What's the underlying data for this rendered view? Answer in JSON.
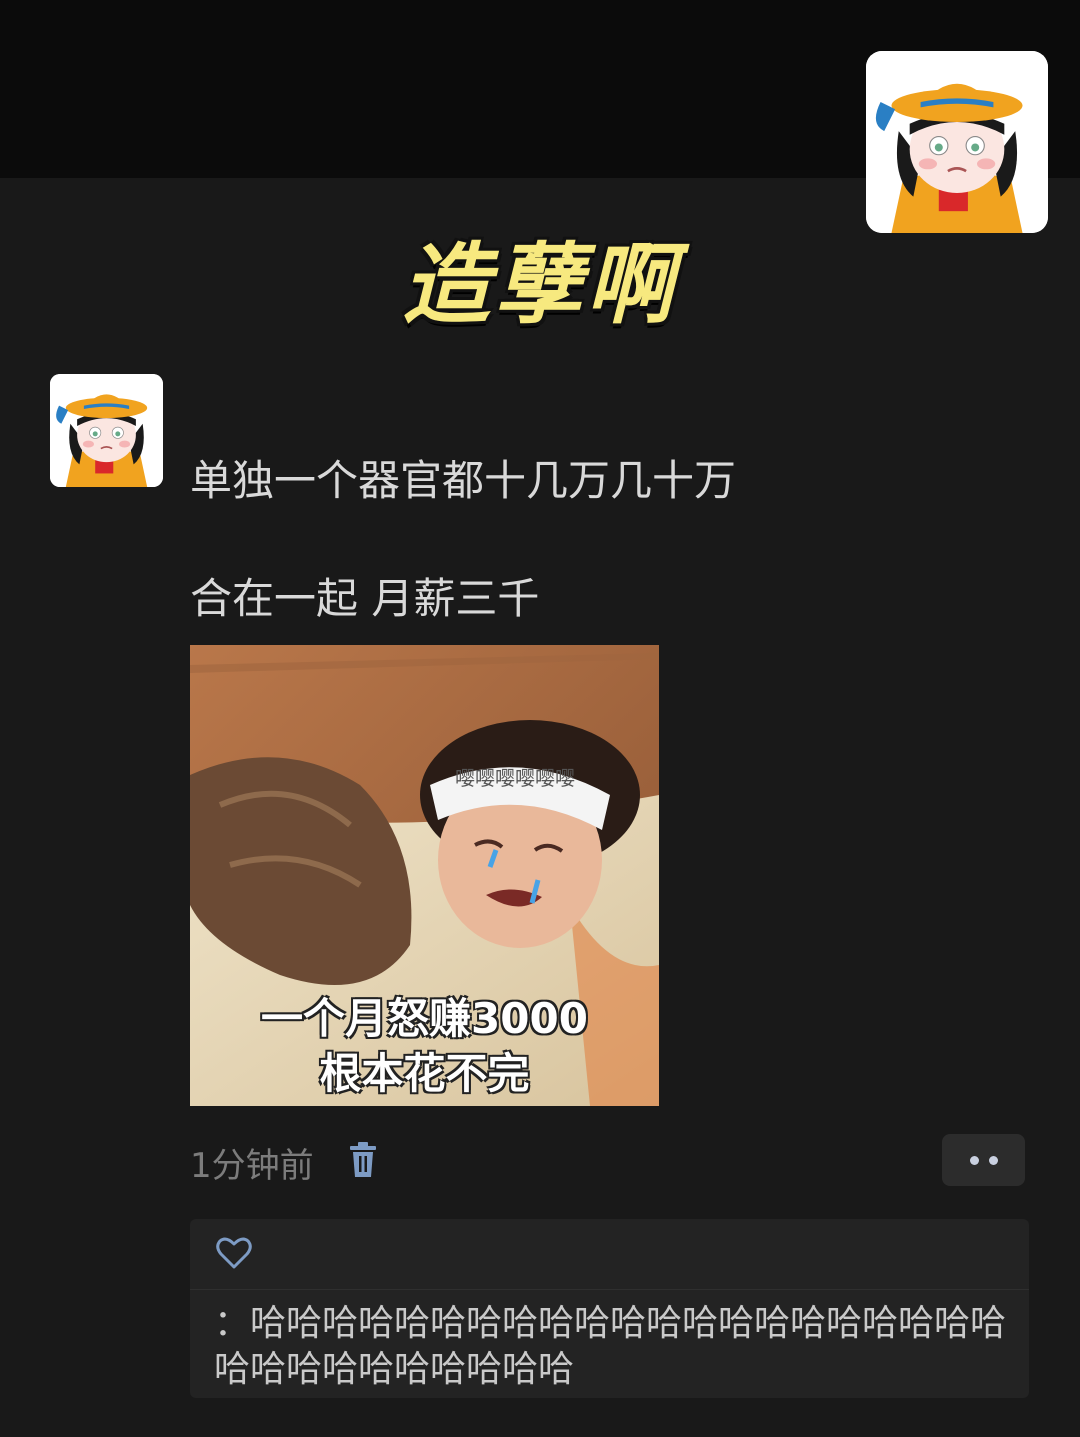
{
  "banner": {
    "title": "造孽啊"
  },
  "post": {
    "username": "",
    "text_line_1": "单独一个器官都十几万几十万",
    "text_line_2": "合在一起 月薪三千",
    "image_caption_1": "一个月怒赚3000",
    "image_caption_2": "根本花不完",
    "headband_text": "嘤嘤嘤嘤嘤嘤",
    "timestamp": "1分钟前"
  },
  "interactions": {
    "liker": "",
    "comment_author": "",
    "comment_separator": "：",
    "comment_text": "哈哈哈哈哈哈哈哈哈哈哈哈哈哈哈哈哈哈哈哈哈哈哈哈哈哈哈哈哈哈哈"
  },
  "icons": [
    "trash-icon",
    "more-dots-icon",
    "heart-icon"
  ],
  "colors": {
    "background": "#191919",
    "title_yellow": "#f7e97f",
    "icon_blue": "#7d9bc4"
  }
}
